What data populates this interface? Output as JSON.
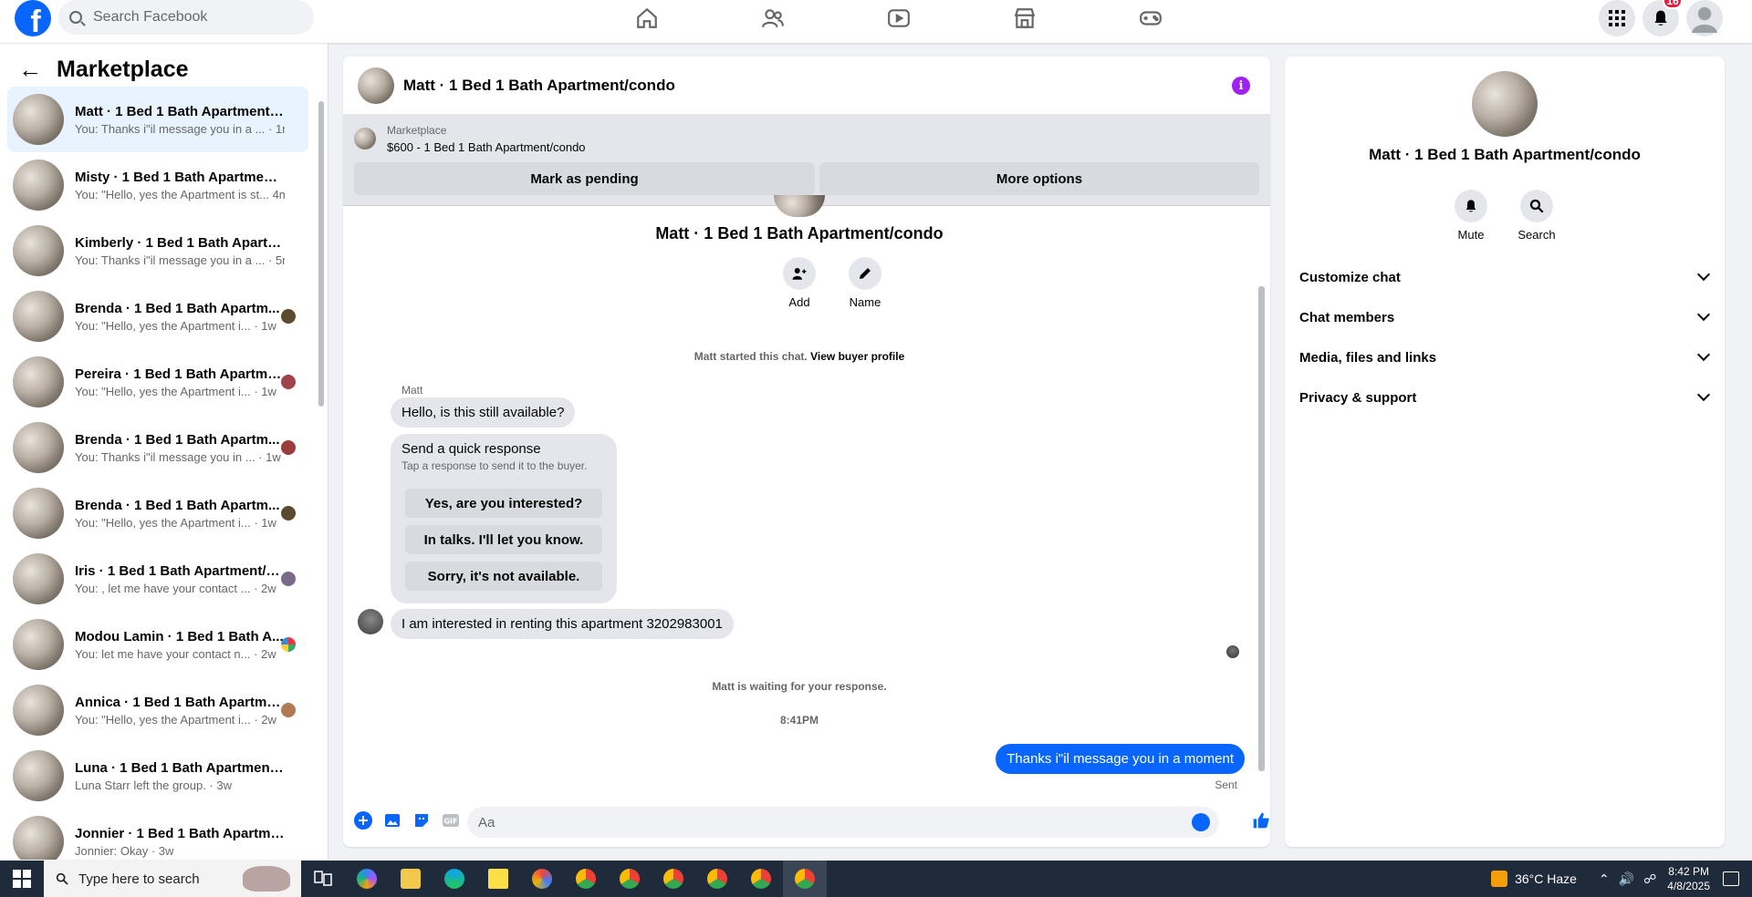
{
  "topnav": {
    "logo_letter": "f",
    "search_placeholder": "Search Facebook",
    "nav_icons": [
      "home-icon",
      "friends-icon",
      "watch-icon",
      "marketplace-icon",
      "gaming-icon"
    ],
    "notifications_count": "16"
  },
  "sidebar": {
    "title": "Marketplace",
    "conversations": [
      {
        "name": "Matt · 1 Bed 1 Bath Apartment/c...",
        "preview": "You: Thanks i\"il message you in a ... · 1m"
      },
      {
        "name": "Misty · 1 Bed 1 Bath Apartment/...",
        "preview": "You: \"Hello, yes the Apartment is st... 4m"
      },
      {
        "name": "Kimberly · 1 Bed 1 Bath Apartme...",
        "preview": "You: Thanks i\"il message you in a ... · 5m"
      },
      {
        "name": "Brenda · 1 Bed 1 Bath Apartm...",
        "preview": "You: \"Hello, yes the Apartment i... · 1w"
      },
      {
        "name": "Pereira · 1 Bed 1 Bath Apartme...",
        "preview": "You: \"Hello, yes the Apartment i... · 1w"
      },
      {
        "name": "Brenda · 1 Bed 1 Bath Apartm...",
        "preview": "You: Thanks i\"il message you in ... · 1w"
      },
      {
        "name": "Brenda · 1 Bed 1 Bath Apartm...",
        "preview": "You: \"Hello, yes the Apartment i... · 1w"
      },
      {
        "name": "Iris · 1 Bed 1 Bath Apartment/c...",
        "preview": "You: , let me have your contact ... · 2w"
      },
      {
        "name": "Modou Lamin · 1 Bed 1 Bath A...",
        "preview": "You: let me have your contact n... · 2w"
      },
      {
        "name": "Annica · 1 Bed 1 Bath Apartme...",
        "preview": "You: \"Hello, yes the Apartment i... · 2w"
      },
      {
        "name": "Luna · 1 Bed 1 Bath Apartment/c...",
        "preview": "Luna Starr left the group. · 3w"
      },
      {
        "name": "Jonnier · 1 Bed 1 Bath Apartmen...",
        "preview": "Jonnier: Okay · 3w"
      }
    ]
  },
  "chat": {
    "header_title": "Matt · 1 Bed 1 Bath Apartment/condo",
    "listing_source": "Marketplace",
    "listing_title": "$600 - 1 Bed 1 Bath Apartment/condo",
    "mark_pending": "Mark as pending",
    "more_options": "More options",
    "profile_name": "Matt · 1 Bed 1 Bath Apartment/condo",
    "add_label": "Add",
    "name_label": "Name",
    "started_text": "Matt started this chat.",
    "view_buyer": "View buyer profile",
    "sender": "Matt",
    "msg1": "Hello, is this still available?",
    "quick_title": "Send a quick response",
    "quick_sub": "Tap a response to send it to the buyer.",
    "quick_options": [
      "Yes, are you interested?",
      "In talks. I'll let you know.",
      "Sorry, it's not available."
    ],
    "msg2": "I am interested in renting this apartment 3202983001",
    "waiting": "Matt is waiting for your response.",
    "time": "8:41PM",
    "my_msg": "Thanks i\"il message you in a moment",
    "status": "Sent",
    "composer_placeholder": "Aa"
  },
  "info_panel": {
    "name": "Matt · 1 Bed 1 Bath Apartment/condo",
    "mute": "Mute",
    "search": "Search",
    "sections": [
      "Customize chat",
      "Chat members",
      "Media, files and links",
      "Privacy & support"
    ]
  },
  "taskbar": {
    "search_placeholder": "Type here to search",
    "weather": "36°C  Haze",
    "time": "8:42 PM",
    "date": "4/8/2025"
  },
  "colors": {
    "accent": "#0866ff",
    "info": "#a020f0",
    "badge": "#e41e3f"
  }
}
